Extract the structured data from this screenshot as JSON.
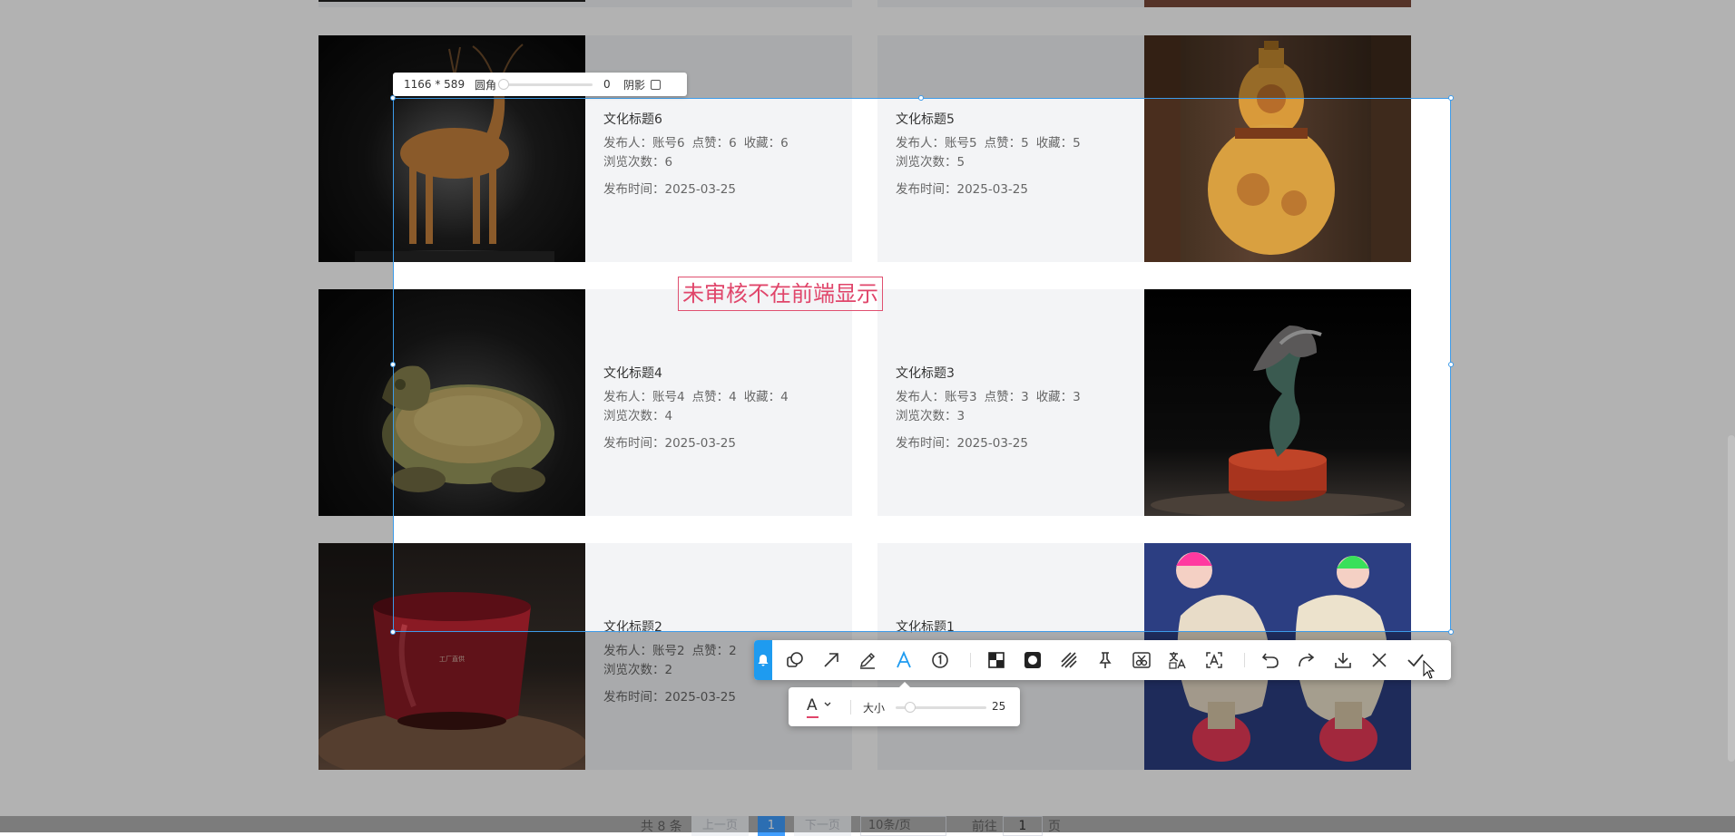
{
  "selection": {
    "dims": "1166 * 589",
    "corner_label": "圆角",
    "corner_value": "0",
    "shadow_label": "阴影"
  },
  "annotation_text": "未审核不在前端显示",
  "cards": [
    {
      "title": "文化标题6",
      "publisher": "发布人：账号6",
      "likes": "点赞：6",
      "favorites": "收藏：6",
      "views": "浏览次数：6",
      "time": "发布时间：2025-03-25",
      "image": "bronze-deer-icon"
    },
    {
      "title": "文化标题5",
      "publisher": "发布人：账号5",
      "likes": "点赞：5",
      "favorites": "收藏：5",
      "views": "浏览次数：5",
      "time": "发布时间：2025-03-25",
      "image": "gourd-vase-icon"
    },
    {
      "title": "文化标题4",
      "publisher": "发布人：账号4",
      "likes": "点赞：4",
      "favorites": "收藏：4",
      "views": "浏览次数：4",
      "time": "发布时间：2025-03-25",
      "image": "dragon-turtle-icon"
    },
    {
      "title": "文化标题3",
      "publisher": "发布人：账号3",
      "likes": "点赞：3",
      "favorites": "收藏：3",
      "views": "浏览次数：3",
      "time": "发布时间：2025-03-25",
      "image": "coral-sculpture-icon"
    },
    {
      "title": "文化标题2",
      "publisher": "发布人：账号2",
      "likes": "点赞：2",
      "favorites": "",
      "views": "浏览次数：2",
      "time": "发布时间：2025-03-25",
      "image": "red-cup-icon"
    },
    {
      "title": "文化标题1",
      "publisher": "",
      "likes": "",
      "favorites": "",
      "views": "",
      "time": "",
      "image": "shell-dolls-icon"
    }
  ],
  "cup_text": "工厂直供",
  "toolbar_icons": [
    "shape-icon",
    "arrow-icon",
    "pen-icon",
    "text-icon",
    "number-icon",
    "mosaic-icon",
    "blur-icon",
    "hatch-icon",
    "pin-icon",
    "scissors-icon",
    "translate-icon",
    "ocr-icon",
    "undo-icon",
    "redo-icon",
    "download-icon",
    "close-icon",
    "check-icon"
  ],
  "subbar": {
    "font_letter": "A",
    "size_label": "大小",
    "size_value": "25"
  },
  "pager": {
    "total": "共 8 条",
    "prev": "上一页",
    "current": "1",
    "next": "下一页",
    "page_size": "10条/页",
    "goto_label": "前往",
    "goto_value": "1",
    "page_unit": "页"
  },
  "colors": {
    "accent": "#3d9be9",
    "annotation": "#e0456a",
    "bell": "#1e9bf0"
  }
}
